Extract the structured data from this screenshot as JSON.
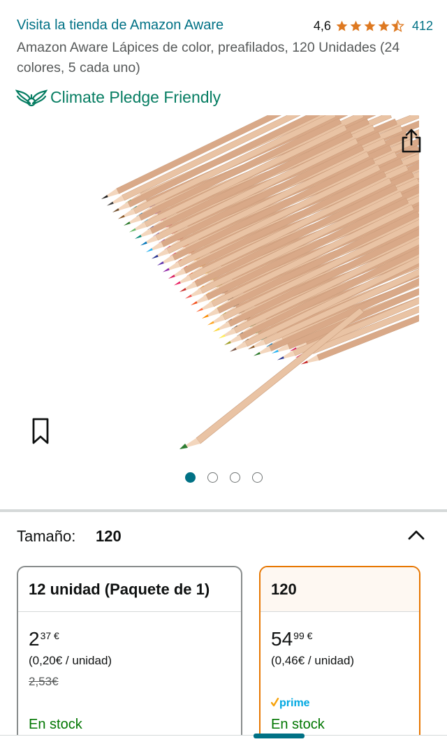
{
  "header": {
    "store_link": "Visita la tienda de Amazon Aware",
    "rating_value": "4,6",
    "rating_stars": 4.5,
    "review_count": "412",
    "title": "Amazon Aware Lápices de color, preafilados, 120 Unidades (24 colores, 5 cada uno)"
  },
  "badge": {
    "label": "Climate Pledge Friendly",
    "icon": "climate-pledge-leaf-icon",
    "color": "#067d62"
  },
  "gallery": {
    "image_alt": "Lápices de color",
    "total_images": 4,
    "active_index": 0
  },
  "size": {
    "label": "Tamaño:",
    "selected": "120",
    "options": [
      {
        "name": "12 unidad (Paquete de 1)",
        "price_whole": "2",
        "price_fraction": "37 €",
        "unit_price": "(0,20€ / unidad)",
        "list_price": "2,53€",
        "prime": false,
        "stock": "En stock"
      },
      {
        "name": "120",
        "price_whole": "54",
        "price_fraction": "99 €",
        "unit_price": "(0,46€ / unidad)",
        "list_price": "",
        "prime": true,
        "prime_label": "prime",
        "stock": "En stock"
      }
    ]
  },
  "colors": {
    "link": "#007185",
    "star": "#de7921",
    "stock": "#007600",
    "selected_border": "#e77600"
  }
}
